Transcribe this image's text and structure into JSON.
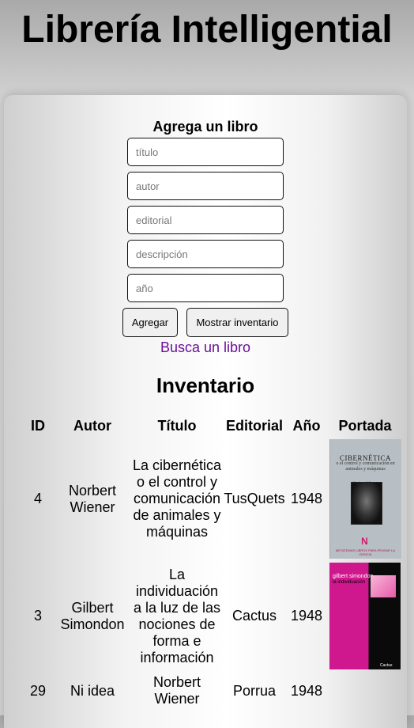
{
  "app": {
    "title": "Librería Intelligential"
  },
  "form": {
    "heading": "Agrega un libro",
    "fields": {
      "titulo": {
        "placeholder": "título",
        "value": ""
      },
      "autor": {
        "placeholder": "autor",
        "value": ""
      },
      "editorial": {
        "placeholder": "editorial",
        "value": ""
      },
      "descripcion": {
        "placeholder": "descripción",
        "value": ""
      },
      "anio": {
        "placeholder": "año",
        "value": ""
      }
    },
    "add_label": "Agregar",
    "show_label": "Mostrar inventario",
    "search_link": "Busca un libro"
  },
  "inventory": {
    "title": "Inventario",
    "columns": {
      "id": "ID",
      "autor": "Autor",
      "titulo": "Título",
      "editorial": "Editorial",
      "anio": "Año",
      "portada": "Portada"
    },
    "rows": [
      {
        "id": "4",
        "autor": "Norbert Wiener",
        "titulo": "La cibernética o el control y comunicación de animales y máquinas",
        "editorial": "TusQuets",
        "anio": "1948",
        "cover": {
          "title": "CIBERNÉTICA",
          "subtitle": "o el control y comunicación en animales y máquinas",
          "author": "Norbert Wiener",
          "logo": "N",
          "series": "METATEMAS LIBROS PARA PENSAR LA CIENCIA"
        }
      },
      {
        "id": "3",
        "autor": "Gilbert Simondon",
        "titulo": "La individuación a la luz de las nociones de forma e información",
        "editorial": "Cactus",
        "anio": "1948",
        "cover": {
          "author": "gilbert simondon",
          "title": "la individuación",
          "publisher": "Cactus"
        }
      },
      {
        "id": "29",
        "autor": "Ni idea",
        "titulo": "Norbert Wiener",
        "editorial": "Porrua",
        "anio": "1948"
      }
    ]
  },
  "colors": {
    "link": "#6a0f9a",
    "cover_magenta": "#d0188e"
  }
}
